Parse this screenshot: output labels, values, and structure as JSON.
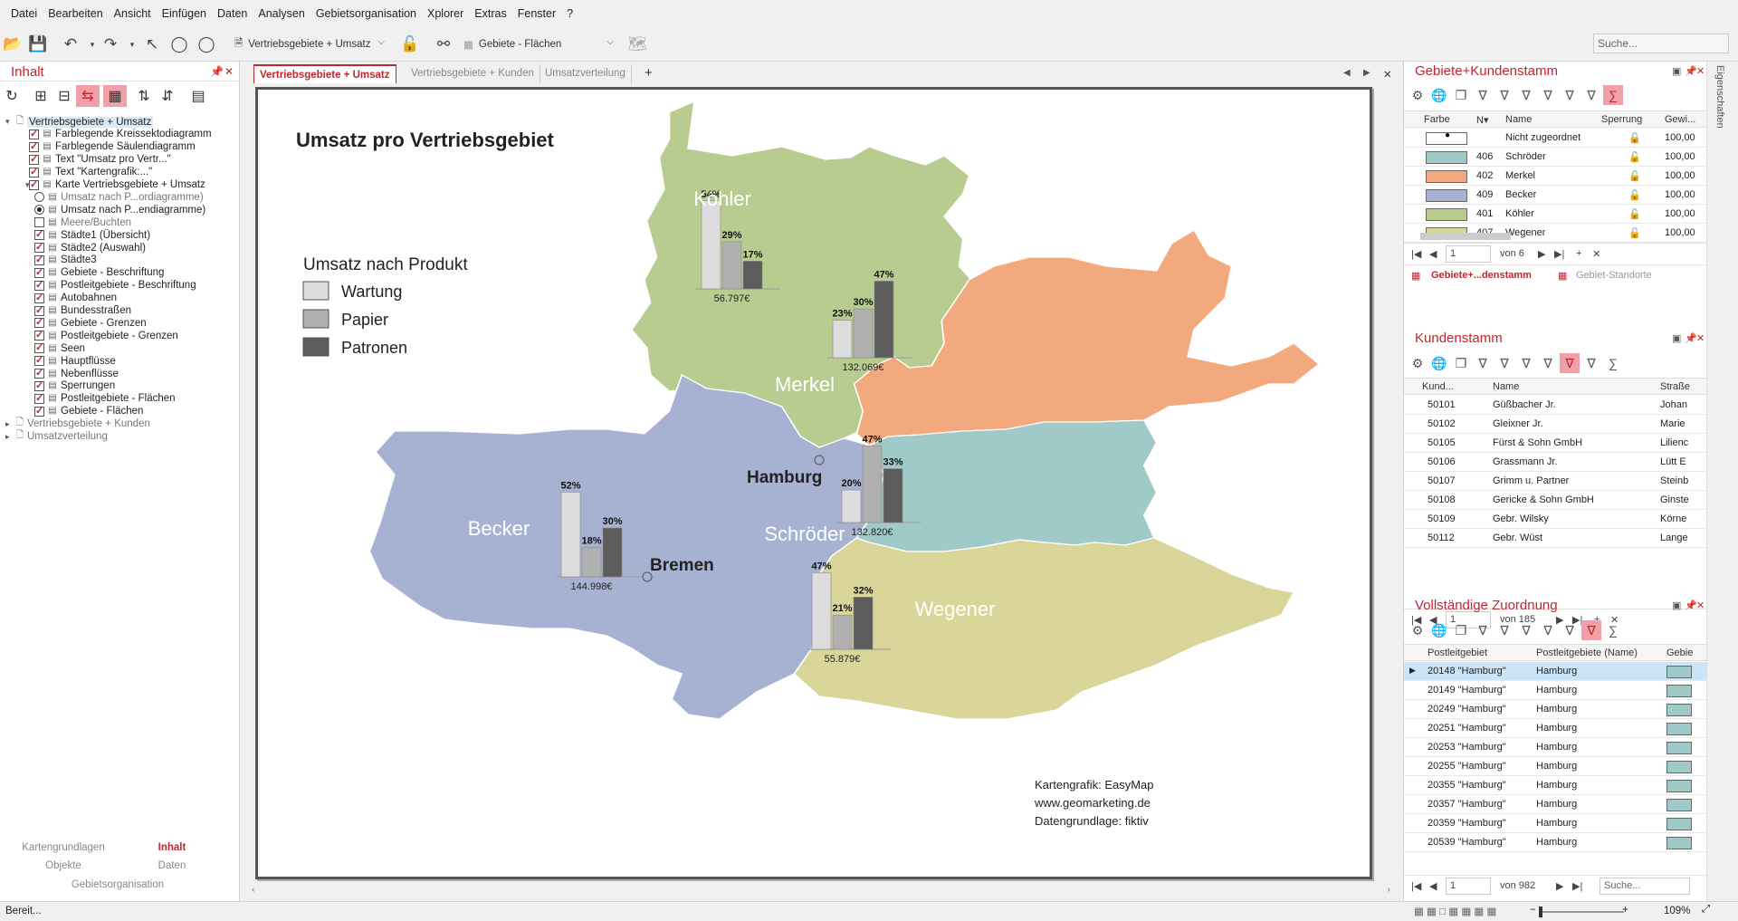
{
  "menu": [
    "Datei",
    "Bearbeiten",
    "Ansicht",
    "Einfügen",
    "Daten",
    "Analysen",
    "Gebietsorganisation",
    "Xplorer",
    "Extras",
    "Fenster",
    "?"
  ],
  "toolbar": {
    "map_combo": "Vertriebsgebiete + Umsatz",
    "layer_combo": "Gebiete - Flächen",
    "search_placeholder": "Suche..."
  },
  "left_panel": {
    "title": "Inhalt",
    "tree": [
      {
        "label": "Vertriebsgebiete + Umsatz",
        "level": 0,
        "type": "doc",
        "expand": "▾",
        "hl": true
      },
      {
        "label": "Farblegende Kreissektodiagramm",
        "level": 1,
        "type": "cb",
        "checked": true
      },
      {
        "label": "Farblegende Säulendiagramm",
        "level": 1,
        "type": "cb",
        "checked": true
      },
      {
        "label": "Text \"Umsatz pro Vertr...\"",
        "level": 1,
        "type": "cb",
        "checked": true
      },
      {
        "label": "Text \"Kartengrafik:...\"",
        "level": 1,
        "type": "cb",
        "checked": true
      },
      {
        "label": "Karte Vertriebsgebiete + Umsatz",
        "level": 1,
        "type": "cb",
        "checked": true,
        "expand": "▾"
      },
      {
        "label": "Umsatz nach P...ordiagramme)",
        "level": 2,
        "type": "radio",
        "sel": false,
        "dim": true
      },
      {
        "label": "Umsatz nach P...endiagramme)",
        "level": 2,
        "type": "radio",
        "sel": true
      },
      {
        "label": "Meere/Buchten",
        "level": 2,
        "type": "cb",
        "checked": false,
        "dim": true
      },
      {
        "label": "Städte1 (Übersicht)",
        "level": 2,
        "type": "cb",
        "checked": true
      },
      {
        "label": "Städte2 (Auswahl)",
        "level": 2,
        "type": "cb",
        "checked": true
      },
      {
        "label": "Städte3",
        "level": 2,
        "type": "cb",
        "checked": true
      },
      {
        "label": "Gebiete - Beschriftung",
        "level": 2,
        "type": "cb",
        "checked": true
      },
      {
        "label": "Postleitgebiete - Beschriftung",
        "level": 2,
        "type": "cb",
        "checked": true
      },
      {
        "label": "Autobahnen",
        "level": 2,
        "type": "cb",
        "checked": true
      },
      {
        "label": "Bundesstraßen",
        "level": 2,
        "type": "cb",
        "checked": true
      },
      {
        "label": "Gebiete - Grenzen",
        "level": 2,
        "type": "cb",
        "checked": true
      },
      {
        "label": "Postleitgebiete - Grenzen",
        "level": 2,
        "type": "cb",
        "checked": true
      },
      {
        "label": "Seen",
        "level": 2,
        "type": "cb",
        "checked": true
      },
      {
        "label": "Hauptflüsse",
        "level": 2,
        "type": "cb",
        "checked": true
      },
      {
        "label": "Nebenflüsse",
        "level": 2,
        "type": "cb",
        "checked": true
      },
      {
        "label": "Sperrungen",
        "level": 2,
        "type": "cb",
        "checked": true
      },
      {
        "label": "Postleitgebiete - Flächen",
        "level": 2,
        "type": "cb",
        "checked": true
      },
      {
        "label": "Gebiete - Flächen",
        "level": 2,
        "type": "cb",
        "checked": true
      },
      {
        "label": "Vertriebsgebiete + Kunden",
        "level": 0,
        "type": "doc",
        "expand": "▸",
        "dim": true
      },
      {
        "label": "Umsatzverteilung",
        "level": 0,
        "type": "doc",
        "expand": "▸",
        "dim": true
      }
    ],
    "bottom_tabs": {
      "t1": "Kartengrundlagen",
      "t2": "Inhalt",
      "t3": "Objekte",
      "t4": "Daten",
      "t5": "Gebietsorganisation"
    }
  },
  "doc_tabs": [
    "Vertriebsgebiete + Umsatz",
    "Vertriebsgebiete + Kunden",
    "Umsatzverteilung"
  ],
  "map": {
    "title": "Umsatz pro Vertriebsgebiet",
    "legend_title": "Umsatz nach Produkt",
    "legend": [
      {
        "label": "Wartung",
        "color": "#dcdcdc"
      },
      {
        "label": "Papier",
        "color": "#b0b0b0"
      },
      {
        "label": "Patronen",
        "color": "#5c5c5c"
      }
    ],
    "regions": [
      {
        "name": "Köhler",
        "color": "#b7cc8e",
        "values": [
          54,
          29,
          17
        ],
        "total": "56.797€"
      },
      {
        "name": "Merkel",
        "color": "#f3a97e",
        "values": [
          23,
          30,
          47
        ],
        "total": "132.069€"
      },
      {
        "name": "Becker",
        "color": "#a7b2d2",
        "values": [
          52,
          18,
          30
        ],
        "total": "144.998€"
      },
      {
        "name": "Schröder",
        "color": "#9fcac7",
        "values": [
          20,
          47,
          33
        ],
        "total": "132.820€"
      },
      {
        "name": "Wegener",
        "color": "#dad599",
        "values": [
          47,
          21,
          32
        ],
        "total": "55.879€"
      }
    ],
    "cities": {
      "hamburg": "Hamburg",
      "bremen": "Bremen"
    },
    "credits": {
      "c1": "Kartengrafik: EasyMap",
      "c2": "www.geomarketing.de",
      "c3": "Datengrundlage: fiktiv"
    }
  },
  "gebiete_panel": {
    "title": "Gebiete+Kundenstamm",
    "cols": [
      "Farbe",
      "N▾",
      "Name",
      "Sperrung",
      "Gewi..."
    ],
    "rows": [
      {
        "color": "#ffffff",
        "n": "",
        "name": "Nicht zugeordnet",
        "gew": "100,00"
      },
      {
        "color": "#9fcac7",
        "n": "406",
        "name": "Schröder",
        "gew": "100,00"
      },
      {
        "color": "#f3a97e",
        "n": "402",
        "name": "Merkel",
        "gew": "100,00"
      },
      {
        "color": "#a7b2d2",
        "n": "409",
        "name": "Becker",
        "gew": "100,00"
      },
      {
        "color": "#b7cc8e",
        "n": "401",
        "name": "Köhler",
        "gew": "100,00"
      },
      {
        "color": "#dad599",
        "n": "407",
        "name": "Wegener",
        "gew": "100,00"
      }
    ],
    "page": "1",
    "of": "von 6",
    "subtabs": [
      "Gebiete+...denstamm",
      "Gebiet-Standorte"
    ]
  },
  "kunden_panel": {
    "title": "Kundenstamm",
    "cols": [
      "Kund...",
      "Name",
      "Straße"
    ],
    "rows": [
      {
        "k": "50101",
        "name": "Güßbacher Jr.",
        "str": "Johan"
      },
      {
        "k": "50102",
        "name": "Gleixner Jr.",
        "str": "Marie"
      },
      {
        "k": "50105",
        "name": "Fürst & Sohn GmbH",
        "str": "Lilienc"
      },
      {
        "k": "50106",
        "name": "Grassmann Jr.",
        "str": "Lütt E"
      },
      {
        "k": "50107",
        "name": "Grimm u. Partner",
        "str": "Steinb"
      },
      {
        "k": "50108",
        "name": "Gericke & Sohn GmbH",
        "str": "Ginste"
      },
      {
        "k": "50109",
        "name": "Gebr. Wilsky",
        "str": "Körne"
      },
      {
        "k": "50112",
        "name": "Gebr. Wüst",
        "str": "Lange"
      }
    ],
    "page": "1",
    "of": "von 185"
  },
  "zuordnung_panel": {
    "title": "Vollständige Zuordnung",
    "cols": [
      "Postleitgebiet",
      "Postleitgebiete (Name)",
      "Gebie"
    ],
    "rows": [
      {
        "plz": "20148 \"Hamburg\"",
        "name": "Hamburg",
        "sel": true
      },
      {
        "plz": "20149 \"Hamburg\"",
        "name": "Hamburg"
      },
      {
        "plz": "20249 \"Hamburg\"",
        "name": "Hamburg"
      },
      {
        "plz": "20251 \"Hamburg\"",
        "name": "Hamburg"
      },
      {
        "plz": "20253 \"Hamburg\"",
        "name": "Hamburg"
      },
      {
        "plz": "20255 \"Hamburg\"",
        "name": "Hamburg"
      },
      {
        "plz": "20355 \"Hamburg\"",
        "name": "Hamburg"
      },
      {
        "plz": "20357 \"Hamburg\"",
        "name": "Hamburg"
      },
      {
        "plz": "20359 \"Hamburg\"",
        "name": "Hamburg"
      },
      {
        "plz": "20539 \"Hamburg\"",
        "name": "Hamburg"
      }
    ],
    "gebiet_color": "#9fcac7",
    "page": "1",
    "of": "von 982",
    "search_placeholder": "Suche..."
  },
  "side_strip": "Eigenschaften",
  "status": {
    "text": "Bereit...",
    "zoom": "109%"
  }
}
